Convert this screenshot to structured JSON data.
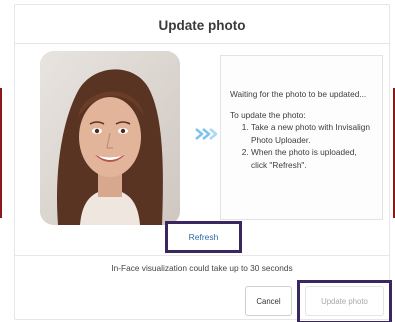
{
  "dialog": {
    "title": "Update photo",
    "status_text": "Waiting for the photo to be updated...",
    "instructions_heading": "To update the photo:",
    "steps": [
      "Take a new photo with Invisalign Photo Uploader.",
      "When the photo is uploaded, click \"Refresh\"."
    ],
    "refresh_label": "Refresh",
    "hint": "In-Face visualization could take up to 30 seconds",
    "cancel_label": "Cancel",
    "update_label": "Update photo"
  },
  "colors": {
    "link": "#2f67a8",
    "highlight_outline": "#3b2760",
    "arrow": "#7fc4ea",
    "disabled_text": "#a8a8a8"
  },
  "icons": {
    "arrow": "double-chevron-right-icon"
  }
}
